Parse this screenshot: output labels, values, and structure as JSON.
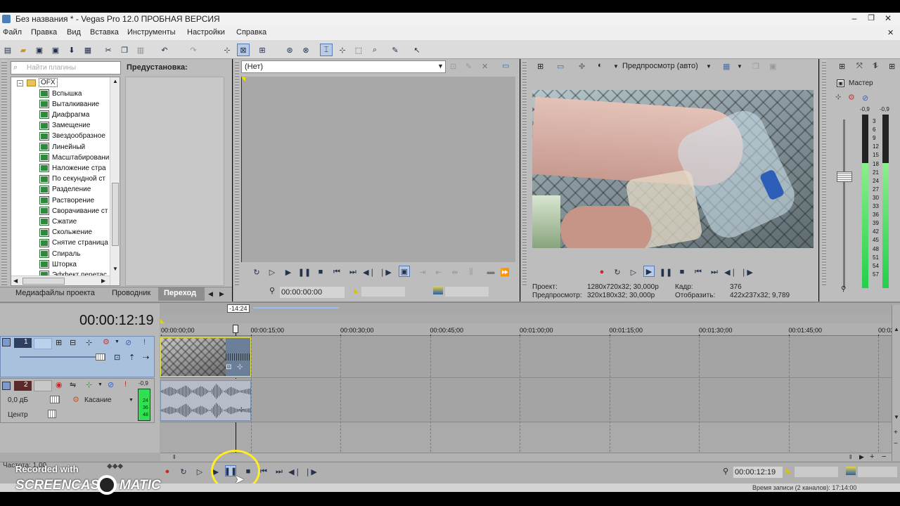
{
  "window": {
    "title": "Без названия * - Vegas Pro 12.0 ПРОБНАЯ ВЕРСИЯ"
  },
  "menu": [
    "Файл",
    "Правка",
    "Вид",
    "Вставка",
    "Инструменты",
    "Настройки",
    "Справка"
  ],
  "plugins": {
    "search_placeholder": "Найти плагины",
    "root": "OFX",
    "preset_label": "Предустановка:",
    "items": [
      "Вспышка",
      "Выталкивание",
      "Диафрагма",
      "Замещение",
      "Звездообразное",
      "Линейный",
      "Масштабировани",
      "Наложение стра",
      "По секундной ст",
      "Разделение",
      "Растворение",
      "Сворачивание ст",
      "Сжатие",
      "Скольжение",
      "Снятие страница",
      "Спираль",
      "Шторка",
      "Эффект перетас"
    ]
  },
  "bottom_tabs": [
    "Медиафайлы проекта",
    "Проводник",
    "Переход"
  ],
  "trimmer": {
    "select_value": "(Нет)",
    "timecode": "00:00:00:00"
  },
  "preview": {
    "mode": "Предпросмотр (авто)",
    "info": {
      "project_label": "Проект:",
      "project_value": "1280x720x32; 30,000p",
      "preview_label": "Предпросмотр:",
      "preview_value": "320x180x32; 30,000p",
      "frame_label": "Кадр:",
      "frame_value": "376",
      "display_label": "Отобразить:",
      "display_value": "422x237x32; 9,789"
    }
  },
  "master": {
    "label": "Мастер",
    "left_peak": "-0,9",
    "right_peak": "-0,9",
    "scale": [
      "3",
      "6",
      "9",
      "12",
      "15",
      "18",
      "21",
      "24",
      "27",
      "30",
      "33",
      "36",
      "39",
      "42",
      "45",
      "48",
      "51",
      "54",
      "57"
    ],
    "level_left": 0.72,
    "level_right": 0.72
  },
  "timeline": {
    "cursor_time": "00:00:12:19",
    "loop_label": "-14:24",
    "ruler": [
      "00:00:00;00",
      "00:00:15;00",
      "00:00:30;00",
      "00:00:45;00",
      "00:01:00;00",
      "00:01:15;00",
      "00:01:30;00",
      "00:01:45;00",
      "00:02:0"
    ],
    "track1": {
      "number": "1"
    },
    "track2": {
      "number": "2",
      "volume": "0,0 дБ",
      "mode": "Касание",
      "pan": "Центр",
      "peak": "-0,9",
      "meter": [
        "24",
        "36",
        "48"
      ]
    }
  },
  "status": {
    "rate": "Частота: 1,00",
    "timecode": "00:00:12:19",
    "record_time": "Время записи (2 каналов): 17:14:00"
  },
  "watermark": {
    "line1": "Recorded with",
    "line2": "SCREENCAST",
    "line3": "MATIC"
  },
  "colors": {
    "title_bar": "#0a0a0a",
    "panel": "#bdbdbd",
    "track_selected": "#a9c1dc",
    "video_clip": "#e6e64a",
    "audio_wave": "#b02a3a",
    "meter_green": "#22d04a",
    "highlight_circle": "#ffee22"
  }
}
